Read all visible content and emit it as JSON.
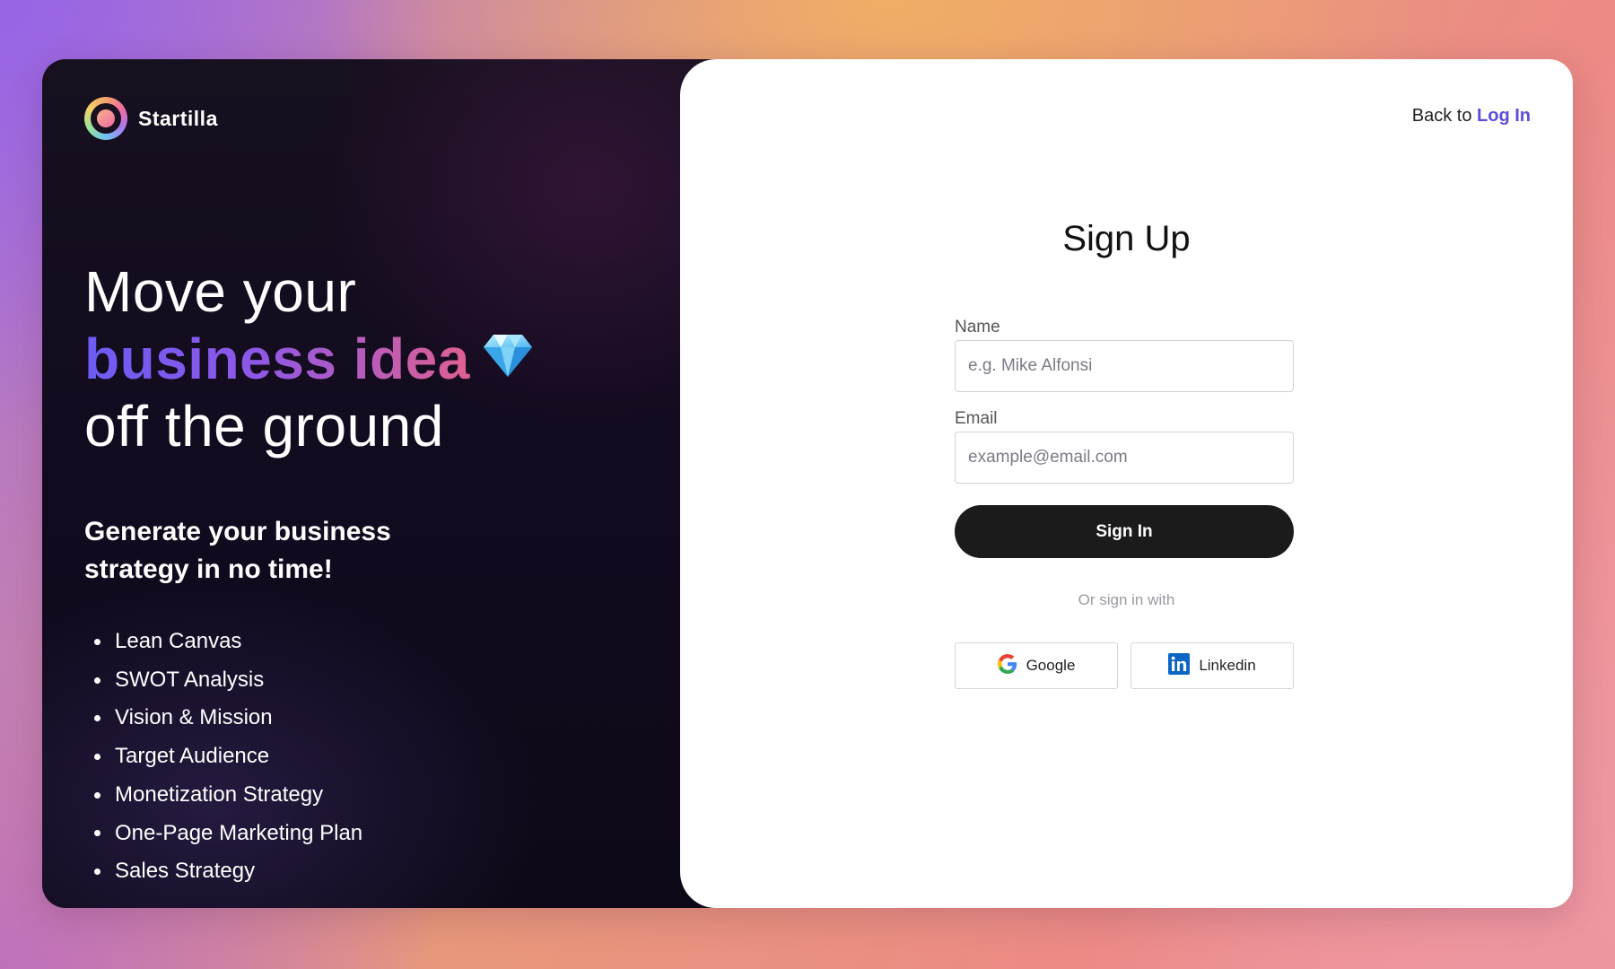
{
  "brand": {
    "name": "Startilla",
    "colors": {
      "accent": "#5b4dd8",
      "gradient_start": "#6c5cf4",
      "gradient_end": "#e06090",
      "button_dark": "#1b1b1b"
    }
  },
  "hero": {
    "line1": "Move your",
    "highlight": "business idea",
    "line3": "off the ground",
    "emoji_icon": "gem-icon"
  },
  "subhead": "Generate your business strategy in no time!",
  "features": [
    "Lean Canvas",
    "SWOT Analysis",
    "Vision & Mission",
    "Target Audience",
    "Monetization Strategy",
    "One-Page Marketing Plan",
    "Sales Strategy"
  ],
  "nav": {
    "back_text": "Back to",
    "login_link": "Log In"
  },
  "form": {
    "title": "Sign Up",
    "name_label": "Name",
    "name_placeholder": "e.g. Mike Alfonsi",
    "email_label": "Email",
    "email_placeholder": "example@email.com",
    "submit_label": "Sign In",
    "or_text": "Or sign in with",
    "google_label": "Google",
    "linkedin_label": "Linkedin"
  }
}
